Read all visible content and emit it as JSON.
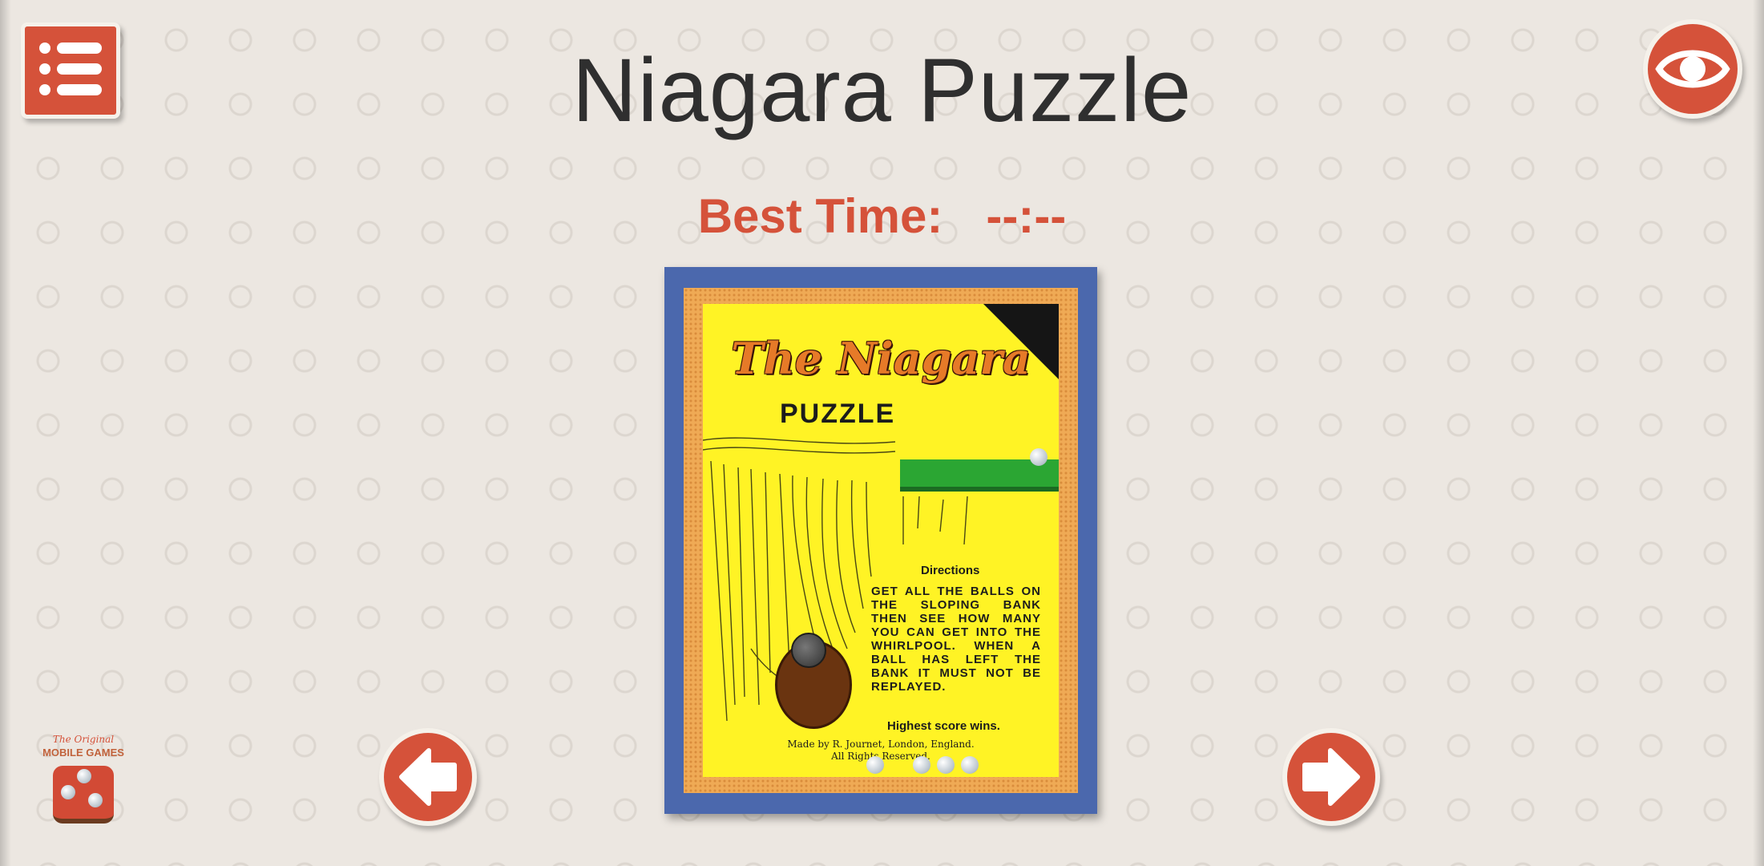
{
  "page": {
    "title": "Niagara Puzzle",
    "best_time_label": "Best Time:",
    "best_time_value": "--:--"
  },
  "toolbar": {
    "menu_icon": "list-menu-icon",
    "view_icon": "eye-icon"
  },
  "navigation": {
    "prev_icon": "arrow-left-icon",
    "next_icon": "arrow-right-icon"
  },
  "puzzle_card": {
    "brand": "The Niagara",
    "subtitle": "PUZZLE",
    "directions_title": "Directions",
    "directions_text": "GET ALL THE BALLS ON THE SLOPING BANK THEN SEE HOW MANY YOU CAN GET INTO THE WHIRLPOOL. WHEN A BALL HAS LEFT THE BANK IT MUST NOT BE REPLAYED.",
    "directions_footer": "Highest score wins.",
    "maker_line1": "Made by R. Journet, London, England.",
    "maker_line2": "All Rights Reserved."
  },
  "logo": {
    "small_text": "The Original",
    "main_text": "MOBILE GAMES"
  },
  "colors": {
    "accent": "#d5523a",
    "frame": "#4b68ad",
    "card": "#fff325",
    "bank": "#2ba633"
  }
}
